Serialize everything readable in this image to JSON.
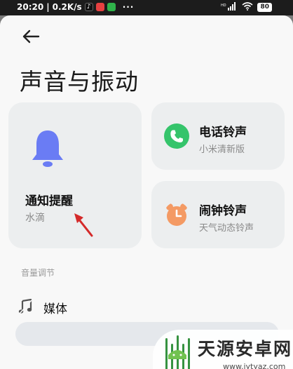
{
  "status_bar": {
    "time": "20:20",
    "speed": "0.2K/s",
    "separator": "|",
    "more": "···",
    "signal": "HD",
    "battery": "80"
  },
  "page": {
    "title": "声音与振动"
  },
  "cards": {
    "notification": {
      "title": "通知提醒",
      "subtitle": "水滴"
    },
    "phone": {
      "title": "电话铃声",
      "subtitle": "小米清新版"
    },
    "alarm": {
      "title": "闹钟铃声",
      "subtitle": "天气动态铃声"
    }
  },
  "volume": {
    "section_label": "音量调节",
    "media_label": "媒体",
    "media_level": 0.0
  },
  "watermark": {
    "title": "天源安卓网",
    "url": "www.jytyaz.com"
  },
  "colors": {
    "bell": "#6a7cf4",
    "phone": "#35c46b",
    "alarm": "#f49a64",
    "arrow": "#d42a2a"
  }
}
